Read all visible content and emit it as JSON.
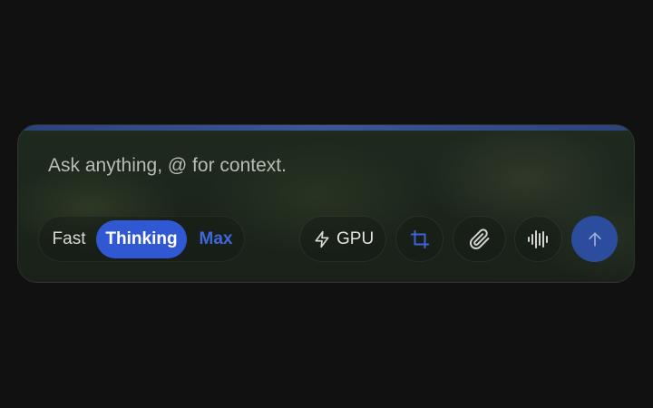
{
  "composer": {
    "placeholder": "Ask anything, @ for context.",
    "value": "",
    "accent_color": "#3b5597"
  },
  "modes": {
    "selected": "Thinking",
    "items": [
      {
        "label": "Fast",
        "active": false
      },
      {
        "label": "Thinking",
        "active": true
      },
      {
        "label": "Max",
        "active": false
      }
    ],
    "active_color": "#2f58d2"
  },
  "toolbar": {
    "gpu_label": "GPU",
    "gpu_icon": "lightning-bolt-icon",
    "crop_icon": "crop-icon",
    "attach_icon": "paperclip-icon",
    "voice_icon": "audio-waveform-icon",
    "send_icon": "arrow-up-icon",
    "send_color": "#2c4d9e"
  }
}
